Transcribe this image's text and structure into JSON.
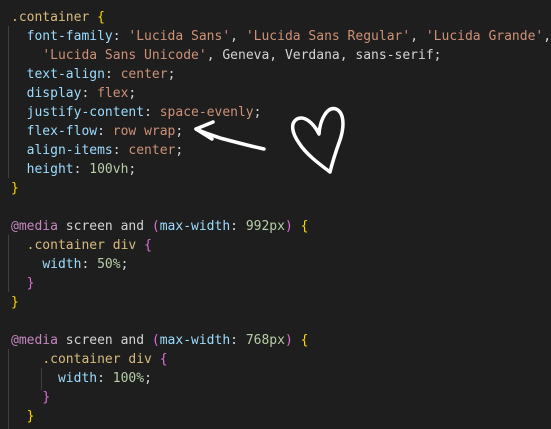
{
  "editor": {
    "background": "#1e1e1e",
    "lines": [
      {
        "segments": [
          {
            "t": ".container",
            "c": "sel"
          },
          {
            "t": " ",
            "c": "punc"
          },
          {
            "t": "{",
            "c": "brace1"
          }
        ]
      },
      {
        "segments": [
          {
            "t": "  ",
            "c": "punc"
          },
          {
            "t": "font-family",
            "c": "prop"
          },
          {
            "t": ": ",
            "c": "punc"
          },
          {
            "t": "'Lucida Sans'",
            "c": "str"
          },
          {
            "t": ", ",
            "c": "punc"
          },
          {
            "t": "'Lucida Sans Regular'",
            "c": "str"
          },
          {
            "t": ", ",
            "c": "punc"
          },
          {
            "t": "'Lucida Grande'",
            "c": "str"
          },
          {
            "t": ",",
            "c": "punc"
          }
        ]
      },
      {
        "segments": [
          {
            "t": "    ",
            "c": "punc"
          },
          {
            "t": "'Lucida Sans Unicode'",
            "c": "str"
          },
          {
            "t": ", Geneva, Verdana, sans-serif;",
            "c": "punc"
          }
        ]
      },
      {
        "segments": [
          {
            "t": "  ",
            "c": "punc"
          },
          {
            "t": "text-align",
            "c": "prop"
          },
          {
            "t": ": ",
            "c": "punc"
          },
          {
            "t": "center",
            "c": "val"
          },
          {
            "t": ";",
            "c": "punc"
          }
        ]
      },
      {
        "segments": [
          {
            "t": "  ",
            "c": "punc"
          },
          {
            "t": "display",
            "c": "prop"
          },
          {
            "t": ": ",
            "c": "punc"
          },
          {
            "t": "flex",
            "c": "val"
          },
          {
            "t": ";",
            "c": "punc"
          }
        ]
      },
      {
        "segments": [
          {
            "t": "  ",
            "c": "punc"
          },
          {
            "t": "justify-content",
            "c": "prop"
          },
          {
            "t": ": ",
            "c": "punc"
          },
          {
            "t": "space-evenly",
            "c": "val"
          },
          {
            "t": ";",
            "c": "punc"
          }
        ]
      },
      {
        "segments": [
          {
            "t": "  ",
            "c": "punc"
          },
          {
            "t": "flex-flow",
            "c": "prop"
          },
          {
            "t": ": ",
            "c": "punc"
          },
          {
            "t": "row wrap",
            "c": "val"
          },
          {
            "t": ";",
            "c": "punc"
          }
        ]
      },
      {
        "segments": [
          {
            "t": "  ",
            "c": "punc"
          },
          {
            "t": "align-items",
            "c": "prop"
          },
          {
            "t": ": ",
            "c": "punc"
          },
          {
            "t": "center",
            "c": "val"
          },
          {
            "t": ";",
            "c": "punc"
          }
        ]
      },
      {
        "segments": [
          {
            "t": "  ",
            "c": "punc"
          },
          {
            "t": "height",
            "c": "prop"
          },
          {
            "t": ": ",
            "c": "punc"
          },
          {
            "t": "100vh",
            "c": "num"
          },
          {
            "t": ";",
            "c": "punc"
          }
        ]
      },
      {
        "segments": [
          {
            "t": "}",
            "c": "brace1"
          }
        ]
      },
      {
        "segments": []
      },
      {
        "segments": [
          {
            "t": "@media",
            "c": "at"
          },
          {
            "t": " screen and ",
            "c": "punc"
          },
          {
            "t": "(",
            "c": "brace2"
          },
          {
            "t": "max-width",
            "c": "prop"
          },
          {
            "t": ": ",
            "c": "punc"
          },
          {
            "t": "992px",
            "c": "num"
          },
          {
            "t": ")",
            "c": "brace2"
          },
          {
            "t": " ",
            "c": "punc"
          },
          {
            "t": "{",
            "c": "brace1"
          }
        ]
      },
      {
        "segments": [
          {
            "t": "  ",
            "c": "punc"
          },
          {
            "t": ".container div",
            "c": "sel"
          },
          {
            "t": " ",
            "c": "punc"
          },
          {
            "t": "{",
            "c": "brace2"
          }
        ]
      },
      {
        "segments": [
          {
            "t": "    ",
            "c": "punc"
          },
          {
            "t": "width",
            "c": "prop"
          },
          {
            "t": ": ",
            "c": "punc"
          },
          {
            "t": "50%",
            "c": "num"
          },
          {
            "t": ";",
            "c": "punc"
          }
        ]
      },
      {
        "segments": [
          {
            "t": "  ",
            "c": "punc"
          },
          {
            "t": "}",
            "c": "brace2"
          }
        ]
      },
      {
        "segments": [
          {
            "t": "}",
            "c": "brace1"
          }
        ]
      },
      {
        "segments": []
      },
      {
        "segments": [
          {
            "t": "@media",
            "c": "at"
          },
          {
            "t": " screen and ",
            "c": "punc"
          },
          {
            "t": "(",
            "c": "brace2"
          },
          {
            "t": "max-width",
            "c": "prop"
          },
          {
            "t": ": ",
            "c": "punc"
          },
          {
            "t": "768px",
            "c": "num"
          },
          {
            "t": ")",
            "c": "brace2"
          },
          {
            "t": " ",
            "c": "punc"
          },
          {
            "t": "{",
            "c": "brace1"
          }
        ]
      },
      {
        "segments": [
          {
            "t": "    ",
            "c": "punc"
          },
          {
            "t": ".container div",
            "c": "sel"
          },
          {
            "t": " ",
            "c": "punc"
          },
          {
            "t": "{",
            "c": "brace2"
          }
        ]
      },
      {
        "segments": [
          {
            "t": "      ",
            "c": "punc"
          },
          {
            "t": "width",
            "c": "prop"
          },
          {
            "t": ": ",
            "c": "punc"
          },
          {
            "t": "100%",
            "c": "num"
          },
          {
            "t": ";",
            "c": "punc"
          }
        ]
      },
      {
        "segments": [
          {
            "t": "    ",
            "c": "punc"
          },
          {
            "t": "}",
            "c": "brace2"
          }
        ]
      },
      {
        "segments": [
          {
            "t": "  ",
            "c": "punc"
          },
          {
            "t": "}",
            "c": "brace1"
          }
        ]
      }
    ]
  },
  "annotation": {
    "stroke_color": "#ffffff",
    "arrow": "arrow pointing left",
    "heart": "hand-drawn heart"
  }
}
